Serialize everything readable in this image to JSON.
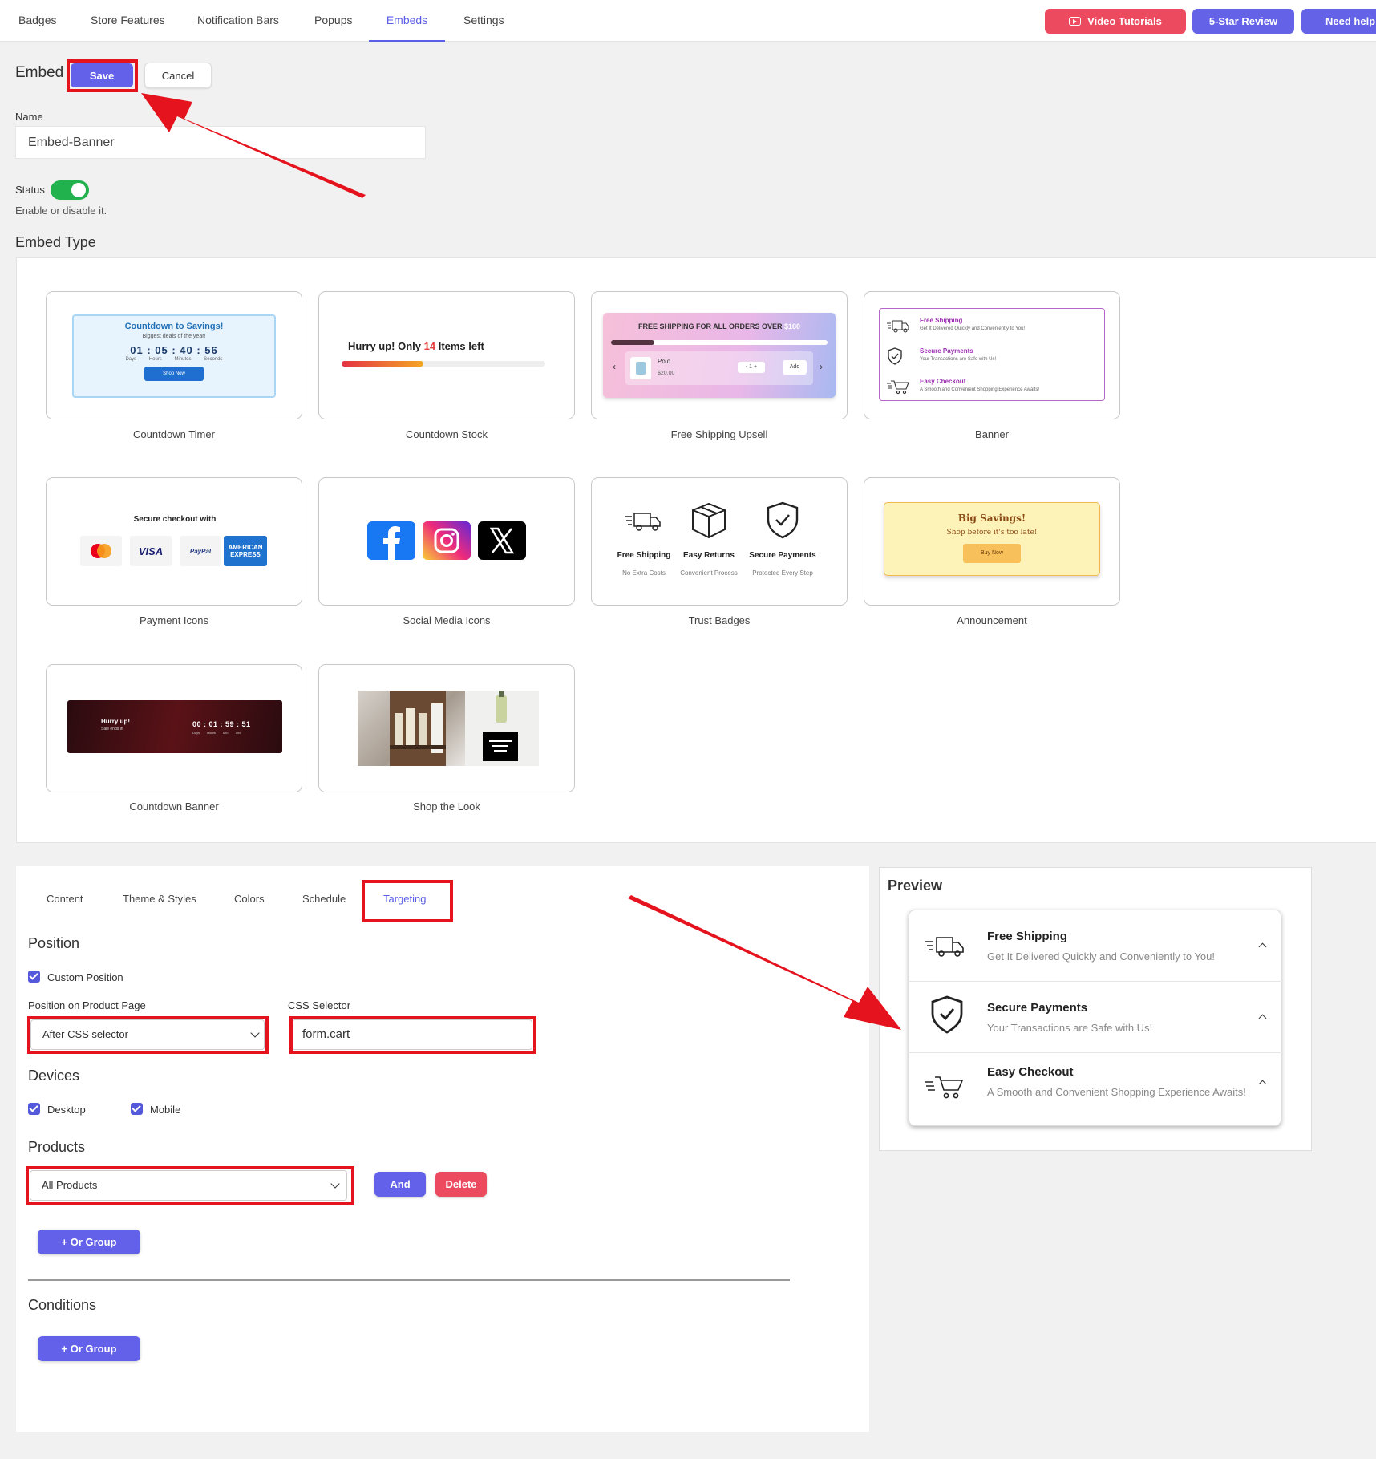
{
  "nav": {
    "tabs": [
      "Badges",
      "Store Features",
      "Notification Bars",
      "Popups",
      "Embeds",
      "Settings"
    ],
    "active_tab": "Embeds",
    "video_tutorials": "Video Tutorials",
    "review": "5-Star Review",
    "help": "Need help"
  },
  "header": {
    "title": "Embed",
    "save": "Save",
    "cancel": "Cancel"
  },
  "form": {
    "name_label": "Name",
    "name_value": "Embed-Banner",
    "status_label": "Status",
    "status_on": true,
    "status_help": "Enable or disable it.",
    "embed_type_heading": "Embed Type"
  },
  "embed_types": {
    "countdown_timer": {
      "label": "Countdown Timer",
      "title": "Countdown to Savings!",
      "subtitle": "Biggest deals of the year!",
      "digits": "01 : 05 : 40 : 56",
      "units": "Days Hours Minutes Seconds",
      "button": "Shop Now"
    },
    "countdown_stock": {
      "label": "Countdown Stock",
      "text_before": "Hurry up! Only ",
      "count": "14",
      "text_after": " Items left",
      "progress": 0.4
    },
    "free_shipping": {
      "label": "Free Shipping Upsell",
      "title": "FREE SHIPPING FOR ALL ORDERS OVER ",
      "amount": "$180",
      "progress": 0.2,
      "product": "Polo",
      "price": "$20.00",
      "qty": "- 1 +",
      "add": "Add"
    },
    "banner": {
      "label": "Banner",
      "rows": [
        {
          "title": "Free Shipping",
          "sub": "Get It Delivered Quickly and Conveniently to You!"
        },
        {
          "title": "Secure Payments",
          "sub": "Your Transactions are Safe with Us!"
        },
        {
          "title": "Easy Checkout",
          "sub": "A Smooth and Convenient Shopping Experience Awaits!"
        }
      ]
    },
    "payment_icons": {
      "label": "Payment Icons",
      "title": "Secure checkout with",
      "visa": "VISA",
      "paypal": "PayPal",
      "amex": "AMERICAN EXPRESS"
    },
    "social_icons": {
      "label": "Social Media Icons"
    },
    "trust_badges": {
      "label": "Trust Badges",
      "items": [
        {
          "title": "Free Shipping",
          "sub": "No Extra Costs"
        },
        {
          "title": "Easy Returns",
          "sub": "Convenient Process"
        },
        {
          "title": "Secure Payments",
          "sub": "Protected Every Step"
        }
      ]
    },
    "announcement": {
      "label": "Announcement",
      "title": "Big Savings!",
      "sub": "Shop before it's too late!",
      "button": "Buy Now"
    },
    "countdown_banner": {
      "label": "Countdown Banner",
      "hurry": "Hurry up!",
      "sub": "Sale ends in",
      "time": "00 : 01 : 59 : 51",
      "units": "Days Hours Min Sec"
    },
    "shop_the_look": {
      "label": "Shop the Look"
    }
  },
  "config": {
    "tabs": [
      "Content",
      "Theme & Styles",
      "Colors",
      "Schedule",
      "Targeting"
    ],
    "active_tab": "Targeting",
    "position_heading": "Position",
    "custom_position": "Custom Position",
    "position_label": "Position on Product Page",
    "position_value": "After CSS selector",
    "css_label": "CSS Selector",
    "css_value": "form.cart",
    "devices_heading": "Devices",
    "desktop": "Desktop",
    "mobile": "Mobile",
    "products_heading": "Products",
    "products_value": "All Products",
    "and": "And",
    "delete": "Delete",
    "or_group": "+ Or Group",
    "conditions_heading": "Conditions"
  },
  "preview": {
    "title": "Preview",
    "rows": [
      {
        "title": "Free Shipping",
        "sub": "Get It Delivered Quickly and Conveniently to You!"
      },
      {
        "title": "Secure Payments",
        "sub": "Your Transactions are Safe with Us!"
      },
      {
        "title": "Easy Checkout",
        "sub": "A Smooth and Convenient Shopping Experience Awaits!"
      }
    ]
  },
  "colors": {
    "accent": "#5b5fe8",
    "danger": "#ec4b5f",
    "highlight": "#e5131d",
    "success": "#21b24d"
  }
}
